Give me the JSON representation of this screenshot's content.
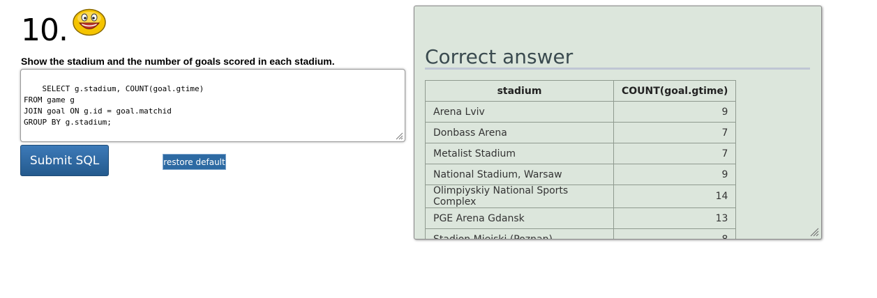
{
  "question": {
    "number": "10.",
    "text": "Show the stadium and the number of goals scored in each stadium.",
    "emoji_icon": "smiley-face-icon"
  },
  "sql_editor": {
    "value": "SELECT g.stadium, COUNT(goal.gtime)\nFROM game g\nJOIN goal ON g.id = goal.matchid\nGROUP BY g.stadium;"
  },
  "buttons": {
    "submit_label": "Submit SQL",
    "restore_label": "restore default"
  },
  "answer": {
    "title": "Correct answer",
    "columns": [
      "stadium",
      "COUNT(goal.gtime)"
    ],
    "rows": [
      {
        "stadium": "Arena Lviv",
        "count": "9"
      },
      {
        "stadium": "Donbass Arena",
        "count": "7"
      },
      {
        "stadium": "Metalist Stadium",
        "count": "7"
      },
      {
        "stadium": "National Stadium, Warsaw",
        "count": "9"
      },
      {
        "stadium": "Olimpiyskiy National Sports Complex",
        "count": "14"
      },
      {
        "stadium": "PGE Arena Gdansk",
        "count": "13"
      },
      {
        "stadium": "Stadion Miejski (Poznan)",
        "count": "8"
      }
    ]
  },
  "colors": {
    "panel_background": "#dce6dc",
    "button_blue": "#2d6aa3",
    "title_text": "#3a4a4f"
  }
}
